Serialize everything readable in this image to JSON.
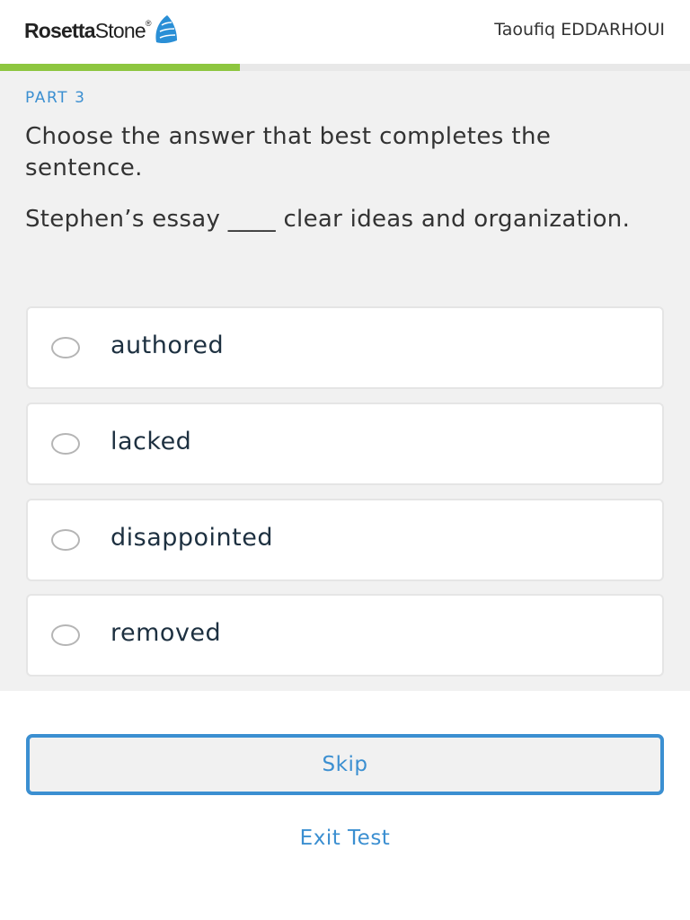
{
  "header": {
    "logo_word1": "Rosetta",
    "logo_word2": "Stone",
    "logo_mark": "®",
    "logo_icon": "sail-icon",
    "user_name": "Taoufiq EDDARHOUI"
  },
  "progress": {
    "fraction": 0.348,
    "color": "#8dc63f"
  },
  "question": {
    "part_label": "PART 3",
    "instruction": "Choose the answer that best completes the sentence.",
    "sentence": "Stephen’s essay ____ clear ideas and organization."
  },
  "options": [
    {
      "label": "authored"
    },
    {
      "label": "lacked"
    },
    {
      "label": "disappointed"
    },
    {
      "label": "removed"
    }
  ],
  "actions": {
    "skip_label": "Skip",
    "exit_label": "Exit Test"
  },
  "colors": {
    "accent": "#3b8fd1",
    "progress": "#8dc63f",
    "panel_background": "#f1f1f1"
  }
}
